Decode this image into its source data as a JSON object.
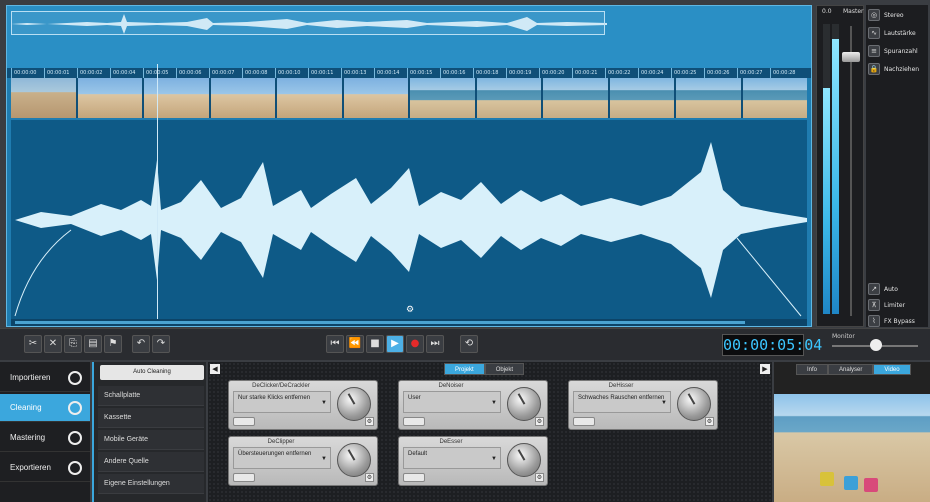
{
  "overview": {},
  "ruler": {
    "ticks": [
      "00:00:00",
      "00:00:01",
      "00:00:02",
      "00:00:04",
      "00:00:05",
      "00:00:06",
      "00:00:07",
      "00:00:08",
      "00:00:10",
      "00:00:11",
      "00:00:13",
      "00:00:14",
      "00:00:15",
      "00:00:16",
      "00:00:18",
      "00:00:19",
      "00:00:20",
      "00:00:21",
      "00:00:22",
      "00:00:24",
      "00:00:25",
      "00:00:26",
      "00:00:27",
      "00:00:28"
    ]
  },
  "thumbnails": [
    "sand",
    "kids",
    "kids",
    "kids",
    "kids",
    "kids",
    "sea",
    "sea",
    "sea",
    "sea",
    "sea",
    "sea"
  ],
  "master": {
    "level": "0.0",
    "label": "Master",
    "left_meter_level": 0.78,
    "right_meter_level": 0.95
  },
  "options": {
    "top": [
      {
        "label": "Stereo",
        "icon": "stereo-icon"
      },
      {
        "label": "Lautstärke",
        "icon": "volume-curve-icon"
      },
      {
        "label": "Spuranzahl",
        "icon": "tracks-icon"
      },
      {
        "label": "Nachziehen",
        "icon": "lock-icon"
      }
    ],
    "bottom": [
      {
        "label": "Auto",
        "icon": "auto-icon"
      },
      {
        "label": "Limiter",
        "icon": "limiter-icon"
      },
      {
        "label": "FX Bypass",
        "icon": "fx-bypass-icon"
      }
    ]
  },
  "transport": {
    "time": "00:00:05:04",
    "monitor_label": "Monitor"
  },
  "nav": {
    "items": [
      {
        "label": "Importieren",
        "active": false
      },
      {
        "label": "Cleaning",
        "active": true
      },
      {
        "label": "Mastering",
        "active": false
      },
      {
        "label": "Exportieren",
        "active": false
      }
    ]
  },
  "presets": {
    "auto_label": "Auto Cleaning",
    "items": [
      "Schallplatte",
      "Kassette",
      "Mobile Geräte",
      "Andere Quelle",
      "Eigene Einstellungen"
    ]
  },
  "plugins": {
    "tabs": [
      {
        "label": "Projekt",
        "active": true
      },
      {
        "label": "Objekt",
        "active": false
      }
    ],
    "modules": [
      {
        "title": "DeClicker/DeCrackler",
        "value": "Nur starke Klicks entfernen"
      },
      {
        "title": "DeNoiser",
        "value": "User"
      },
      {
        "title": "DeHisser",
        "value": "Schwaches Rauschen entfernen"
      },
      {
        "title": "DeClipper",
        "value": "Übersteuerungen entfernen"
      },
      {
        "title": "DeEsser",
        "value": "Default"
      }
    ]
  },
  "preview": {
    "tabs": [
      {
        "label": "Info",
        "active": false
      },
      {
        "label": "Analyser",
        "active": false
      },
      {
        "label": "Video",
        "active": true
      }
    ]
  }
}
